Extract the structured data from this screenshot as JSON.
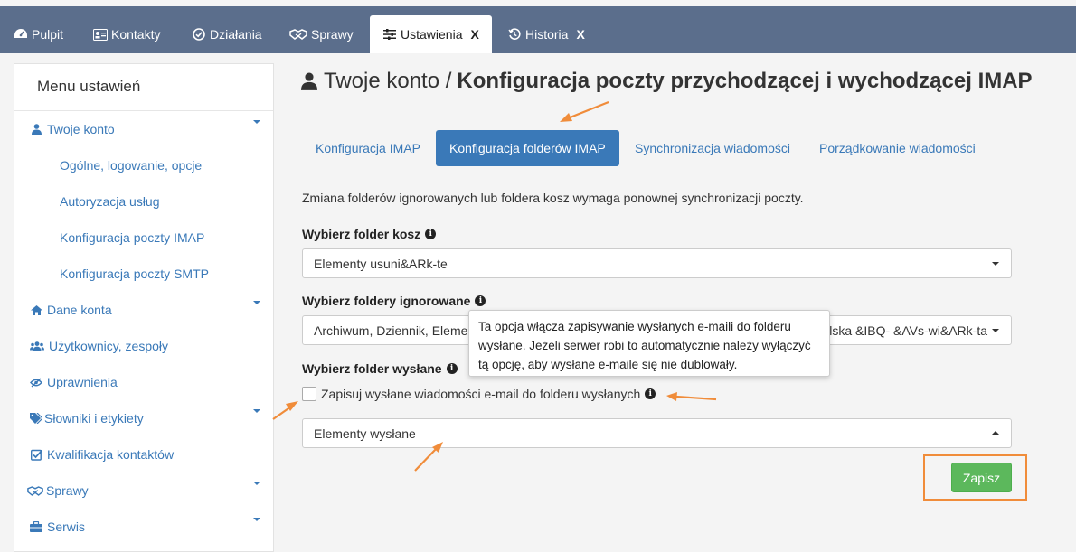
{
  "tabs": [
    {
      "label": "Pulpit",
      "icon": "dashboard-icon"
    },
    {
      "label": "Kontakty",
      "icon": "contact-card-icon"
    },
    {
      "label": "Działania",
      "icon": "check-circle-icon"
    },
    {
      "label": "Sprawy",
      "icon": "handshake-icon"
    },
    {
      "label": "Ustawienia",
      "icon": "sliders-icon",
      "close": "X"
    },
    {
      "label": "Historia",
      "icon": "history-icon",
      "close": "X"
    }
  ],
  "sidebar": {
    "header": "Menu ustawień",
    "items": [
      {
        "label": "Twoje konto",
        "icon": "user-icon"
      },
      {
        "label": "Ogólne, logowanie, opcje"
      },
      {
        "label": "Autoryzacja usług"
      },
      {
        "label": "Konfiguracja poczty IMAP"
      },
      {
        "label": "Konfiguracja poczty SMTP"
      },
      {
        "label": "Dane konta",
        "icon": "home-icon"
      },
      {
        "label": "Użytkownicy, zespoły",
        "icon": "users-icon"
      },
      {
        "label": "Uprawnienia",
        "icon": "eye-slash-icon"
      },
      {
        "label": "Słowniki i etykiety",
        "icon": "tags-icon"
      },
      {
        "label": "Kwalifikacja kontaktów",
        "icon": "check-square-icon"
      },
      {
        "label": "Sprawy",
        "icon": "handshake-icon"
      },
      {
        "label": "Serwis",
        "icon": "briefcase-icon"
      }
    ]
  },
  "page": {
    "title_prefix": "Twoje konto /",
    "title_main": "Konfiguracja poczty przychodzącej i wychodzącej IMAP"
  },
  "subtabs": [
    {
      "label": "Konfiguracja IMAP"
    },
    {
      "label": "Konfiguracja folderów IMAP",
      "active": true
    },
    {
      "label": "Synchronizacja wiadomości"
    },
    {
      "label": "Porządkowanie wiadomości"
    }
  ],
  "form": {
    "info_text": "Zmiana folderów ignorowanych lub foldera kosz wymaga ponownej synchronizacji poczty.",
    "trash_label": "Wybierz folder kosz",
    "trash_value": "Elementy usuni&ARk-te",
    "ignored_label": "Wybierz foldery ignorowane",
    "ignored_value": "Archiwum, Dziennik, Eleme",
    "ignored_value_tail": "olska &IBQ- &AVs-wi&ARk-ta",
    "sent_label": "Wybierz folder wysłane",
    "sent_checkbox_label": "Zapisuj wysłane wiadomości e-mail do folderu wysłanych",
    "sent_value": "Elementy wysłane",
    "save_label": "Zapisz"
  },
  "tooltip": {
    "text": "Ta opcja włącza zapisywanie wysłanych e-maili do folderu wysłane. Jeżeli serwer robi to automatycznie należy wyłączyć tą opcję, aby wysłane e-maile się nie dublowały."
  },
  "colors": {
    "topbar": "#5b6e8c",
    "link": "#3a79b8",
    "primary": "#3a79b8",
    "success": "#5cb85c",
    "annotation": "#f08c3a"
  }
}
